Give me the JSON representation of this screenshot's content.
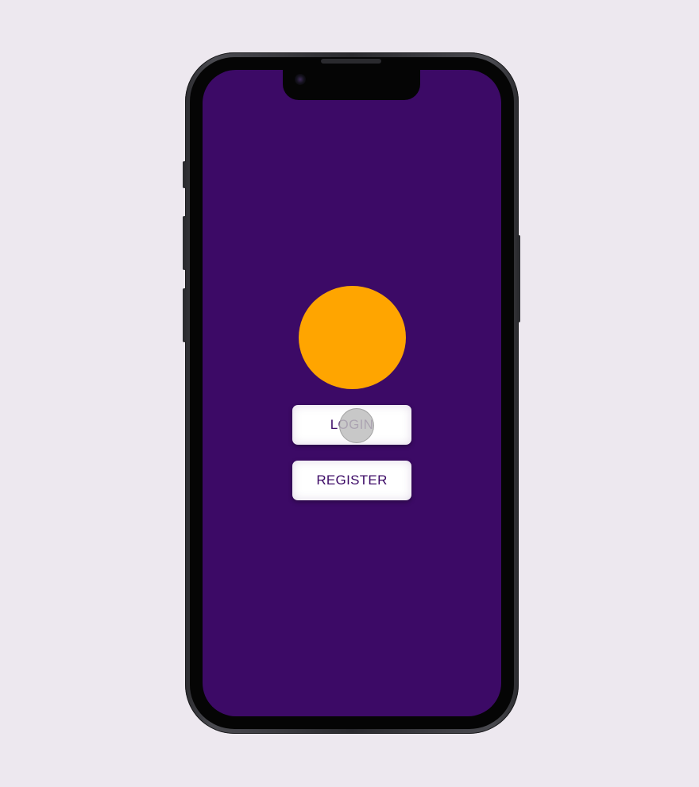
{
  "device": "phone",
  "theme": {
    "background": "#ede8ef",
    "screen_background": "#3c0a66",
    "accent_circle": "#ffa500",
    "button_background": "#ffffff",
    "button_text": "#3c0a66"
  },
  "screen": {
    "logo_icon": "circle-logo",
    "buttons": {
      "login_label": "LOGIN",
      "register_label": "REGISTER"
    }
  }
}
